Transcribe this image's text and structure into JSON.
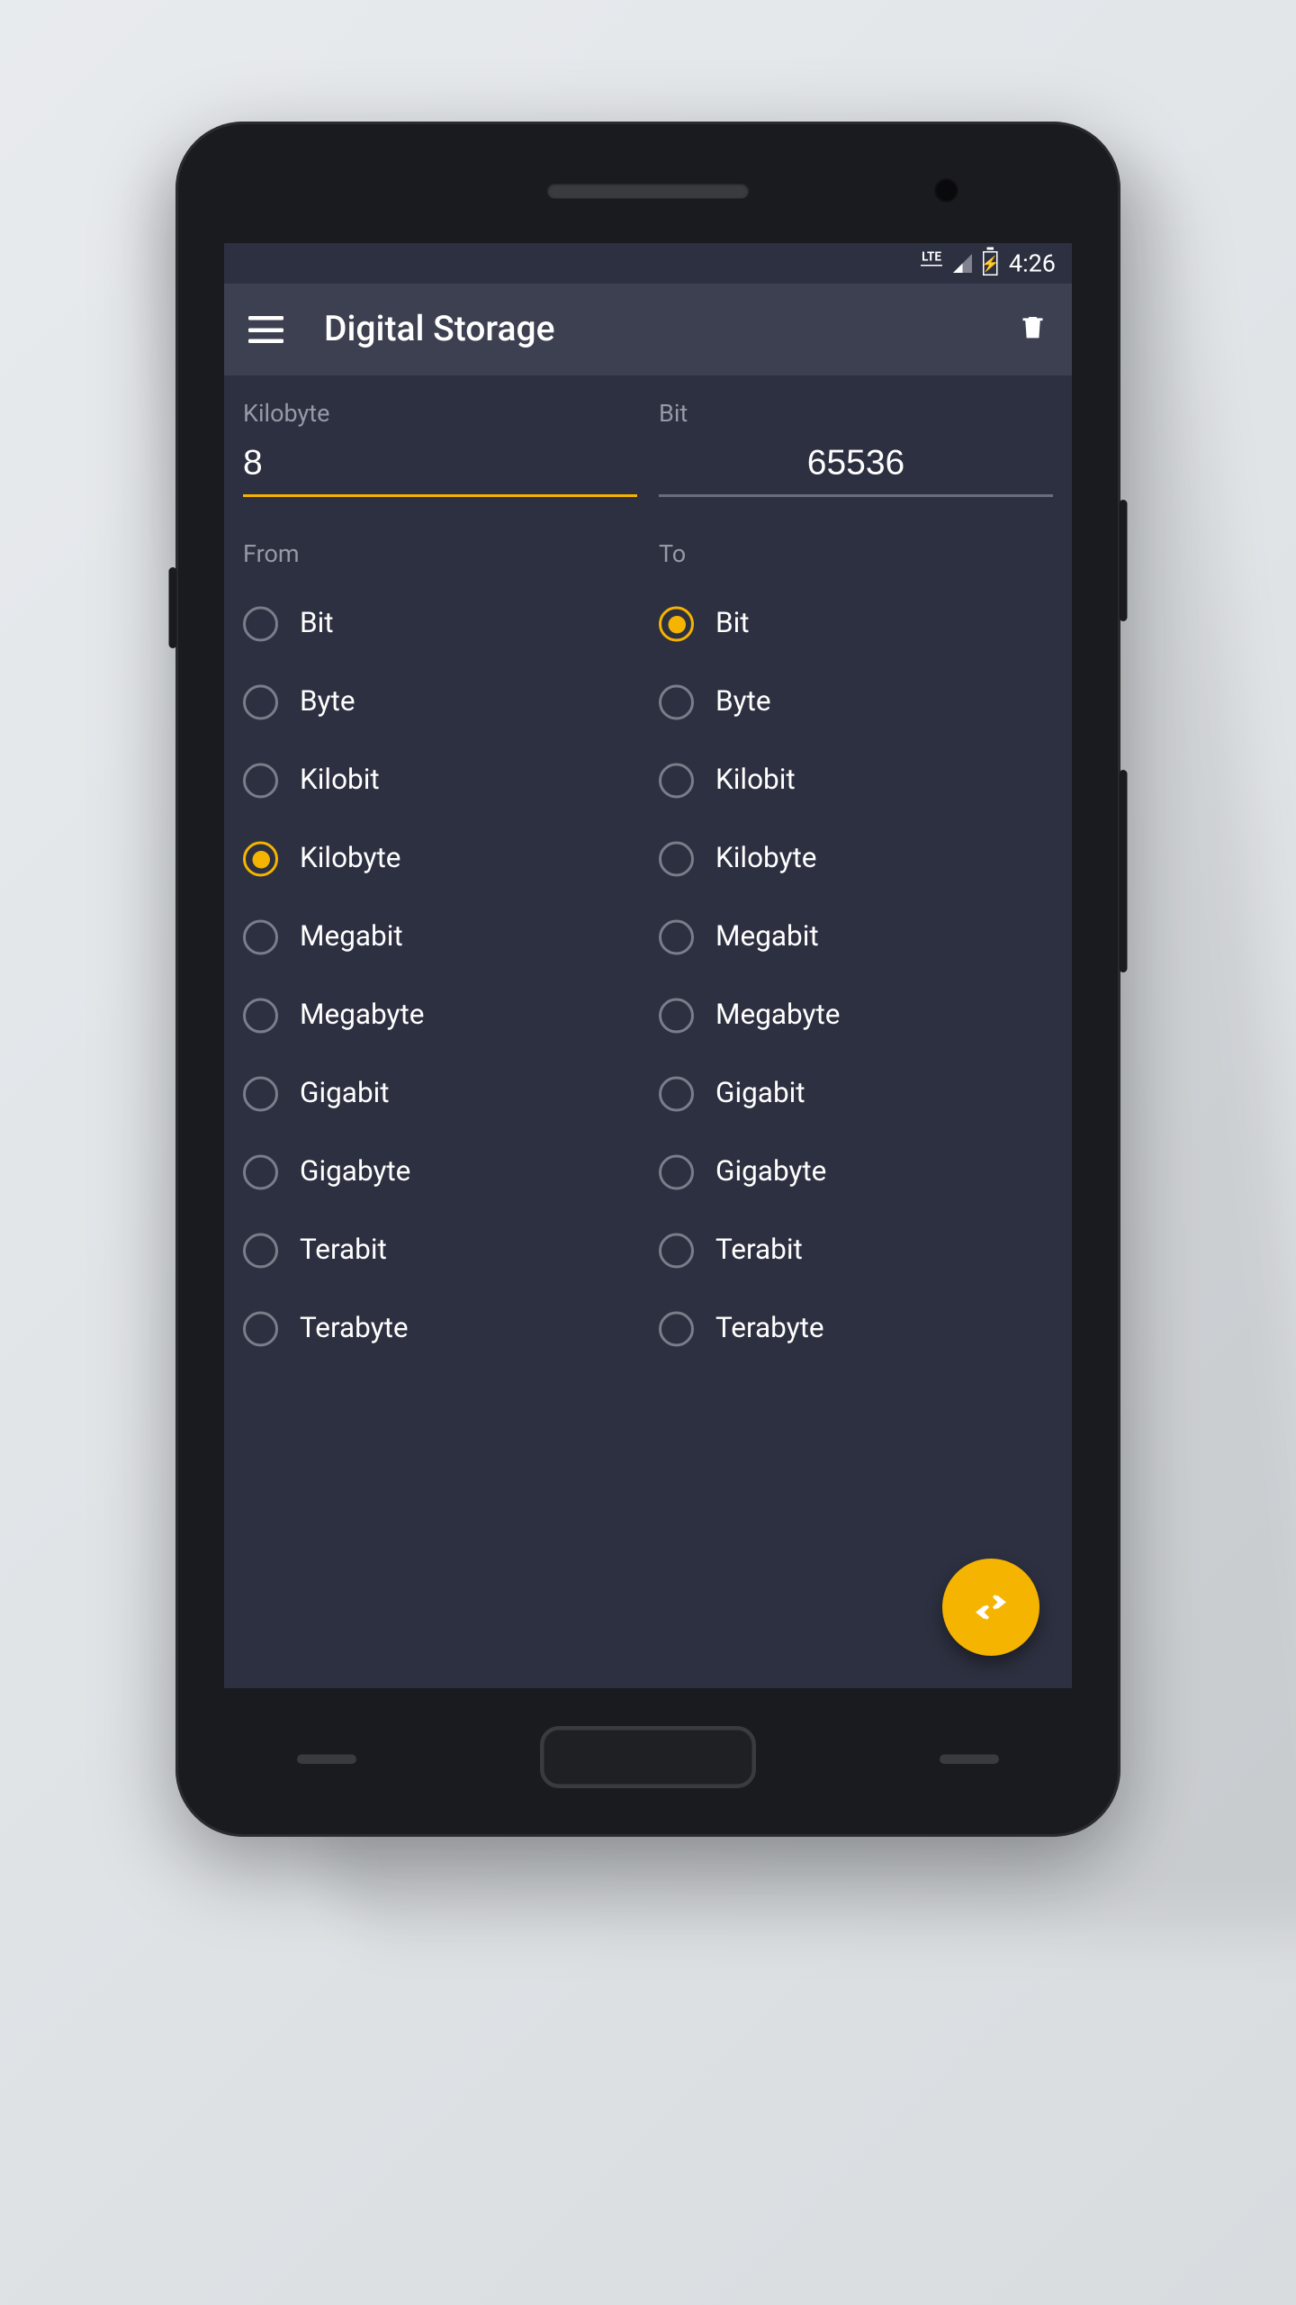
{
  "status": {
    "network_type": "LTE",
    "time": "4:26"
  },
  "appbar": {
    "title": "Digital Storage"
  },
  "from": {
    "unit_label": "Kilobyte",
    "value": "8",
    "section_label": "From",
    "selected": "Kilobyte"
  },
  "to": {
    "unit_label": "Bit",
    "value": "65536",
    "section_label": "To",
    "selected": "Bit"
  },
  "units": [
    "Bit",
    "Byte",
    "Kilobit",
    "Kilobyte",
    "Megabit",
    "Megabyte",
    "Gigabit",
    "Gigabyte",
    "Terabit",
    "Terabyte"
  ],
  "colors": {
    "accent": "#f5b400",
    "bg": "#2d3040",
    "bar": "#3d4050"
  }
}
